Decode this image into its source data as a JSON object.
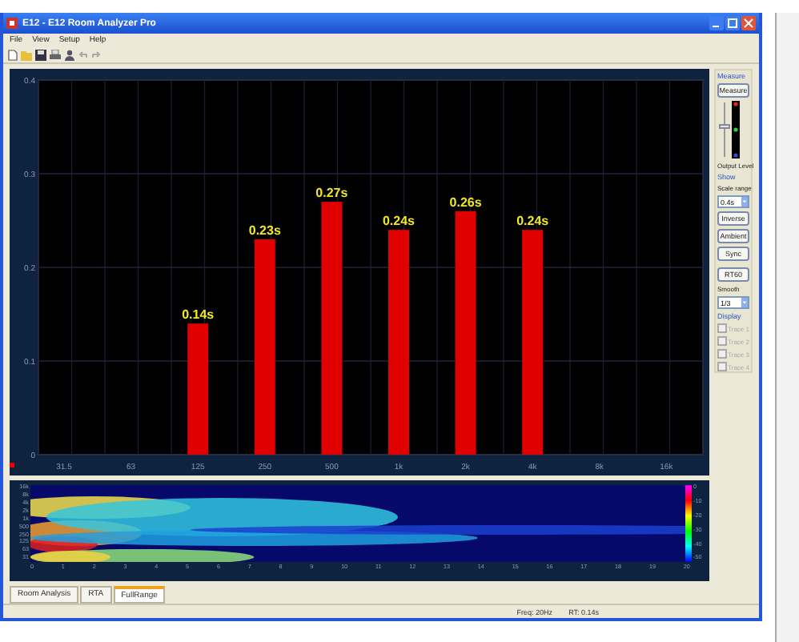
{
  "window": {
    "title": "E12 - E12 Room Analyzer Pro"
  },
  "menu": [
    "File",
    "View",
    "Setup",
    "Help"
  ],
  "chart": {
    "chart_data": {
      "type": "bar",
      "categories": [
        "31.5",
        "63",
        "125",
        "250",
        "500",
        "1k",
        "2k",
        "4k",
        "8k",
        "16k"
      ],
      "values": [
        null,
        null,
        0.14,
        0.23,
        0.27,
        0.24,
        0.26,
        0.24,
        null,
        null
      ],
      "value_labels": [
        null,
        null,
        "0.14s",
        "0.23s",
        "0.27s",
        "0.24s",
        "0.26s",
        "0.24s",
        null,
        null
      ],
      "ylim": [
        0,
        0.4
      ],
      "grid": true,
      "yticks": [
        0,
        0.1,
        0.2,
        0.3,
        0.4
      ]
    }
  },
  "spectrogram": {
    "yticks": [
      "16k",
      "8k",
      "4k",
      "2k",
      "1k",
      "500",
      "250",
      "125",
      "63",
      "31"
    ],
    "xticks": [
      "0",
      "1",
      "2",
      "3",
      "4",
      "5",
      "6",
      "7",
      "8",
      "9",
      "10",
      "11",
      "12",
      "13",
      "14",
      "15",
      "16",
      "17",
      "18",
      "19",
      "20"
    ],
    "scale": [
      "0",
      "-10",
      "-20",
      "-30",
      "-40",
      "-50"
    ]
  },
  "controls": [
    {
      "kind": "group",
      "label": "Measure"
    },
    {
      "kind": "button",
      "label": "Measure"
    },
    {
      "kind": "level",
      "level": 0.55
    },
    {
      "kind": "text",
      "label": "Output Level"
    },
    {
      "kind": "group",
      "label": "Show"
    },
    {
      "kind": "text",
      "label": "Scale range"
    },
    {
      "kind": "select",
      "value": "0.4s"
    },
    {
      "kind": "button",
      "label": "Inverse"
    },
    {
      "kind": "button",
      "label": "Ambient"
    },
    {
      "kind": "button",
      "label": "Sync"
    },
    {
      "kind": "gap"
    },
    {
      "kind": "button",
      "label": "RT60"
    },
    {
      "kind": "text",
      "label": "Smooth"
    },
    {
      "kind": "select",
      "value": "1/3"
    },
    {
      "kind": "group",
      "label": "Display"
    },
    {
      "kind": "check",
      "label": "Trace 1",
      "checked": false,
      "disabled": true
    },
    {
      "kind": "check",
      "label": "Trace 2",
      "checked": false,
      "disabled": true
    },
    {
      "kind": "check",
      "label": "Trace 3",
      "checked": false,
      "disabled": true
    },
    {
      "kind": "check",
      "label": "Trace 4",
      "checked": false,
      "disabled": true
    }
  ],
  "tabs": [
    {
      "label": "Room Analysis",
      "selected": false
    },
    {
      "label": "RTA",
      "selected": false
    },
    {
      "label": "FullRange",
      "selected": true
    }
  ],
  "status_bar": [
    "Freq: 20Hz",
    "RT: 0.14s"
  ]
}
